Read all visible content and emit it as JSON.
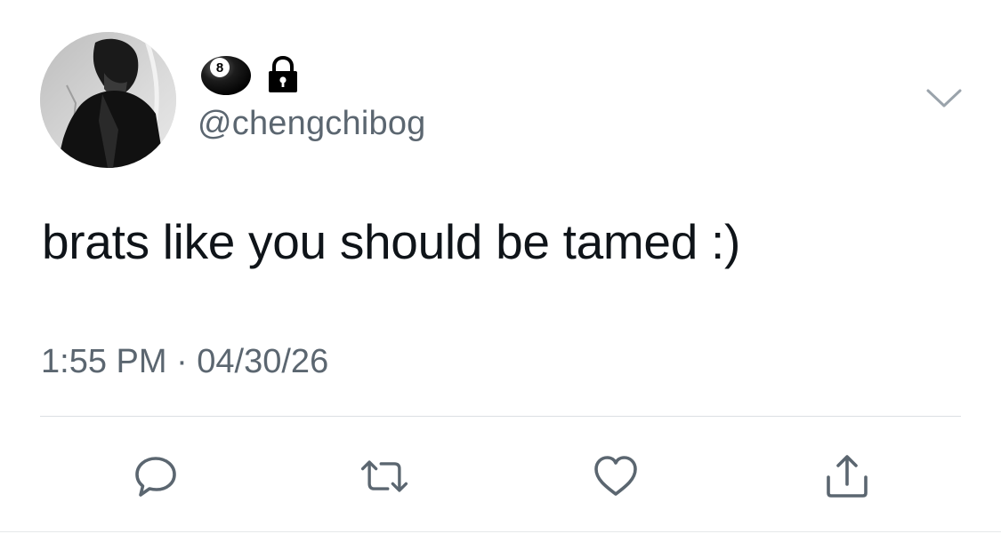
{
  "tweet": {
    "handle": "@chengchibog",
    "display_name_icons": [
      "eight-ball-icon",
      "lock-icon"
    ],
    "eight_ball_digit": "8",
    "text": "brats like you should be tamed :)",
    "timestamp": "1:55 PM · 04/30/26"
  },
  "actions": [
    {
      "name": "reply-button",
      "icon": "speech-bubble-icon"
    },
    {
      "name": "retweet-button",
      "icon": "retweet-arrows-icon"
    },
    {
      "name": "like-button",
      "icon": "heart-icon"
    },
    {
      "name": "share-button",
      "icon": "share-upload-icon"
    }
  ],
  "colors": {
    "text_primary": "#0f1419",
    "text_secondary": "#5b6670",
    "icon": "#5b6670",
    "divider": "#dcdfe3"
  }
}
